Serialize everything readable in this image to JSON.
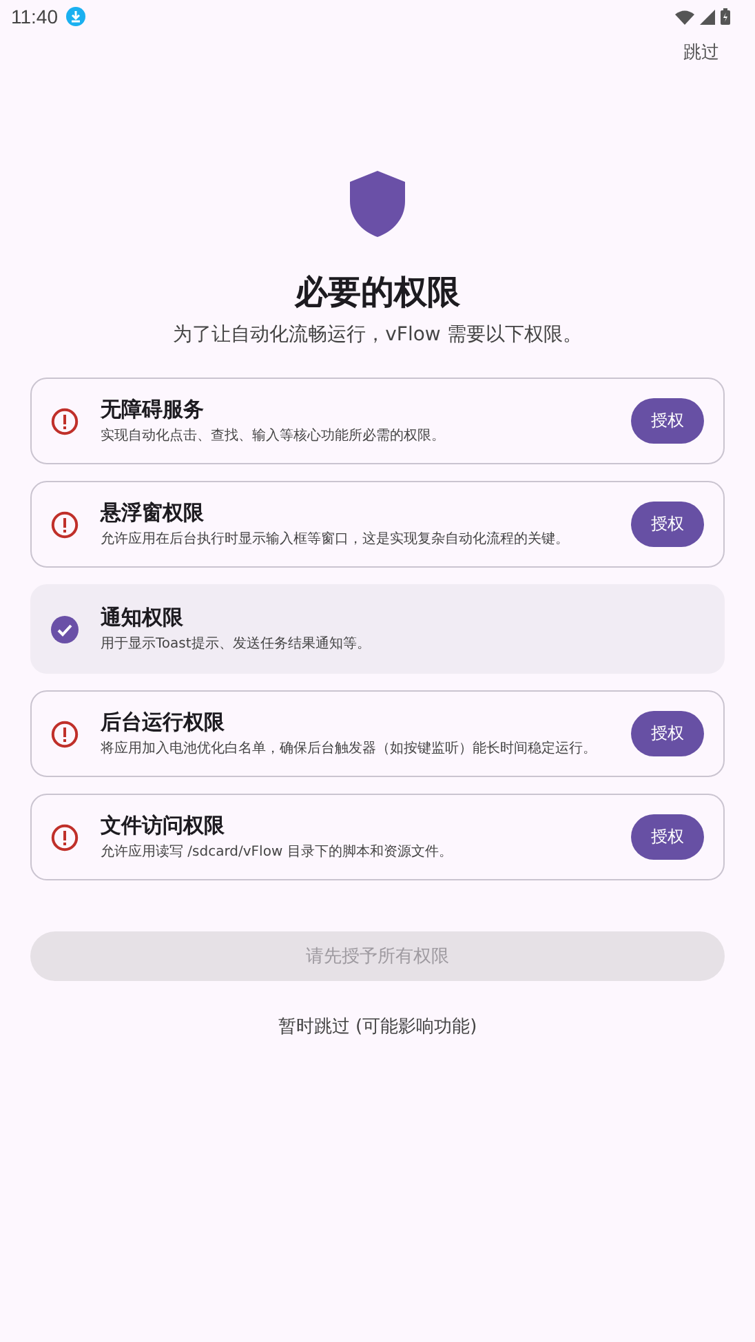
{
  "status_bar": {
    "time": "11:40"
  },
  "skip_top": "跳过",
  "title": "必要的权限",
  "subtitle": "为了让自动化流畅运行，vFlow 需要以下权限。",
  "permissions": [
    {
      "title": "无障碍服务",
      "description": "实现自动化点击、查找、输入等核心功能所必需的权限。",
      "granted": false,
      "button": "授权"
    },
    {
      "title": "悬浮窗权限",
      "description": "允许应用在后台执行时显示输入框等窗口，这是实现复杂自动化流程的关键。",
      "granted": false,
      "button": "授权"
    },
    {
      "title": "通知权限",
      "description": "用于显示Toast提示、发送任务结果通知等。",
      "granted": true
    },
    {
      "title": "后台运行权限",
      "description": "将应用加入电池优化白名单，确保后台触发器（如按键监听）能长时间稳定运行。",
      "granted": false,
      "button": "授权"
    },
    {
      "title": "文件访问权限",
      "description": "允许应用读写 /sdcard/vFlow 目录下的脚本和资源文件。",
      "granted": false,
      "button": "授权"
    }
  ],
  "continue_button": {
    "label": "请先授予所有权限",
    "disabled": true
  },
  "skip_link": "暂时跳过 (可能影响功能)"
}
